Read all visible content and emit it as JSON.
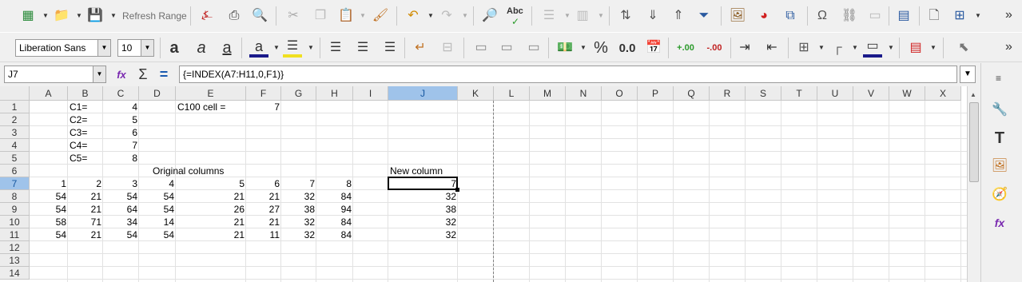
{
  "toolbar1": {
    "refresh_range_label": "Refresh Range",
    "spellcheck_label": "Abc",
    "overflow": "»"
  },
  "toolbar2": {
    "font_name": "Liberation Sans",
    "font_size": "10",
    "number_format_decimal": "0.0",
    "percent_label": "%",
    "add_decimal_label": "+.00",
    "remove_decimal_label": "-.00",
    "overflow": "»"
  },
  "formula_bar": {
    "name_box": "J7",
    "formula": "{=INDEX(A7:H11,0,F1)}"
  },
  "grid": {
    "columns": [
      "A",
      "B",
      "C",
      "D",
      "E",
      "F",
      "G",
      "H",
      "I",
      "J",
      "K",
      "L",
      "M",
      "N",
      "O",
      "P",
      "Q",
      "R",
      "S",
      "T",
      "U",
      "V",
      "W",
      "X"
    ],
    "selected_column": "J",
    "rows": [
      "1",
      "2",
      "3",
      "4",
      "5",
      "6",
      "7",
      "8",
      "9",
      "10",
      "11",
      "12",
      "13",
      "14"
    ],
    "selected_row": "7",
    "cells": {
      "B1": "C1=",
      "C1": "4",
      "E1": "C100 cell =",
      "F1": "7",
      "B2": "C2=",
      "C2": "5",
      "B3": "C3=",
      "C3": "6",
      "B4": "C4=",
      "C4": "7",
      "B5": "C5=",
      "C5": "8",
      "D6": "Original columns",
      "J6": "New column",
      "A7": "1",
      "B7": "2",
      "C7": "3",
      "D7": "4",
      "E7": "5",
      "F7": "6",
      "G7": "7",
      "H7": "8",
      "J7": "7",
      "A8": "54",
      "B8": "21",
      "C8": "54",
      "D8": "54",
      "E8": "21",
      "F8": "21",
      "G8": "32",
      "H8": "84",
      "J8": "32",
      "A9": "54",
      "B9": "21",
      "C9": "64",
      "D9": "54",
      "E9": "26",
      "F9": "27",
      "G9": "38",
      "H9": "94",
      "J9": "38",
      "A10": "58",
      "B10": "71",
      "C10": "34",
      "D10": "14",
      "E10": "21",
      "F10": "21",
      "G10": "32",
      "H10": "84",
      "J10": "32",
      "A11": "54",
      "B11": "21",
      "C11": "54",
      "D11": "54",
      "E11": "21",
      "F11": "11",
      "G11": "32",
      "H11": "84",
      "J11": "32"
    }
  },
  "colors": {
    "selection_header": "#9fc3ea",
    "grid_line": "#e2e2e2",
    "page_break": "#808080"
  }
}
